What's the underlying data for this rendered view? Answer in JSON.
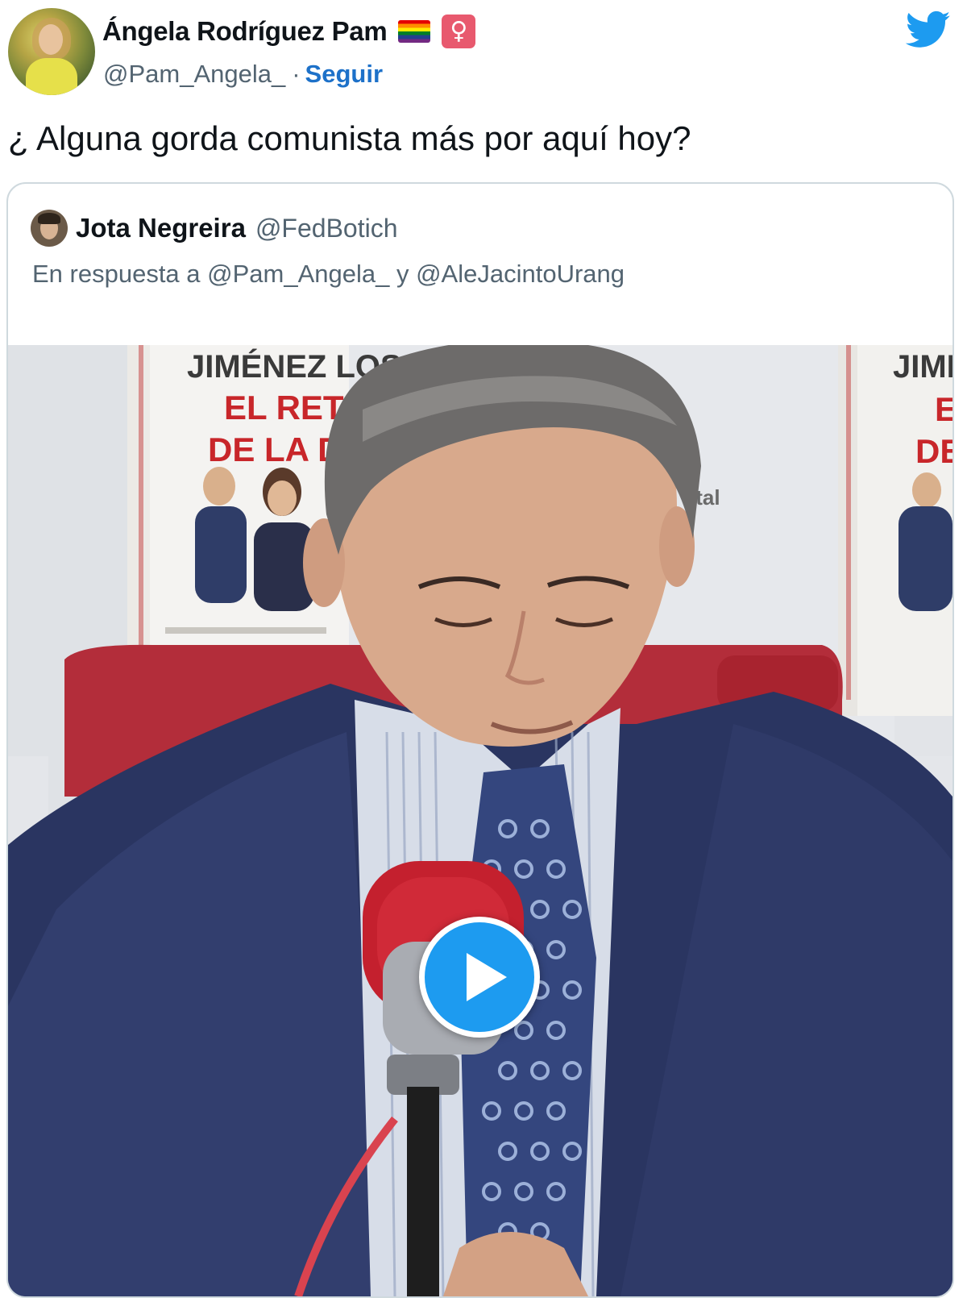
{
  "author": {
    "display_name": "Ángela Rodríguez Pam",
    "handle": "@Pam_Angela_",
    "separator": "·",
    "follow_label": "Seguir",
    "emoji_icons": [
      "rainbow-flag-icon",
      "female-sign-icon"
    ]
  },
  "tweet": {
    "text": "¿ Alguna gorda comunista más por aquí hoy?"
  },
  "quoted_tweet": {
    "display_name": "Jota Negreira",
    "handle": "@FedBotich",
    "reply_context": "En respuesta a @Pam_Angela_ y @AleJacintoUrang",
    "media": {
      "type": "video",
      "play_icon": "play-icon",
      "book_cover_text": {
        "author": "JIMÉNEZ LOSANTO",
        "title_line1": "EL RETORNO",
        "title_line2": "DE LA DERECHA",
        "right_author": "JIMÉN",
        "right_title1": "EL",
        "right_title2": "DE L",
        "publisher_fragment": "ital"
      }
    }
  },
  "brand": {
    "icon": "twitter-bird-icon",
    "color": "#1d9bf0",
    "link_color": "#1d71c9"
  }
}
